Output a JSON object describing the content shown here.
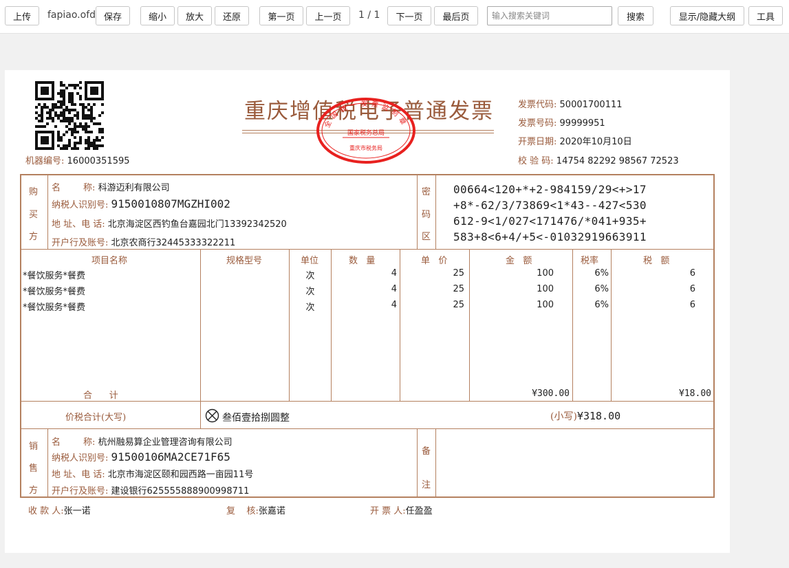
{
  "toolbar": {
    "upload": "上传",
    "filename": "fapiao.ofd",
    "save": "保存",
    "zoom_out": "缩小",
    "zoom_in": "放大",
    "reset": "还原",
    "first_page": "第一页",
    "prev_page": "上一页",
    "page_indicator": "1 / 1",
    "next_page": "下一页",
    "last_page": "最后页",
    "search_placeholder": "输入搜索关键词",
    "search": "搜索",
    "toggle_outline": "显示/隐藏大纲",
    "tools": "工具"
  },
  "invoice": {
    "title": "重庆增值税电子普通发票",
    "machine_no_label": "机器编号:",
    "machine_no": "16000351595",
    "code_label": "发票代码:",
    "code": "50001700111",
    "number_label": "发票号码:",
    "number": "99999951",
    "date_label": "开票日期:",
    "date": "2020年10月10日",
    "check_label": "校 验 码:",
    "check_code": "14754 82292 98567 72523",
    "stamp": {
      "top_text": "全国统一发票监制章",
      "middle_text": "国家税务总局",
      "bottom_text": "重庆市税务局",
      "color": "#e8211f"
    },
    "buyer": {
      "side_label": [
        "购",
        "买",
        "方"
      ],
      "name_label": "名        称:",
      "name": "科游迈利有限公司",
      "tax_id_label": "纳税人识别号:",
      "tax_id": "9150010807MGZHI002",
      "address_label": "地 址、电 话:",
      "address": "北京海淀区西钓鱼台嘉园北门13392342520",
      "bank_label": "开户行及账号:",
      "bank": "北京农商行32445333322211"
    },
    "cipher": {
      "side_label": [
        "密",
        "码",
        "区"
      ],
      "lines": [
        "00664<120+*+2-984159/29<+>17",
        "+8*-62/3/73869<1*43--427<530",
        "612-9<1/027<171476/*041+935+",
        "583+8<6+4/+5<-01032919663911"
      ]
    },
    "columns": {
      "item": "项目名称",
      "spec": "规格型号",
      "unit": "单位",
      "qty": "数   量",
      "price": "单   价",
      "amount": "金   额",
      "rate": "税率",
      "tax": "税   额"
    },
    "items": [
      {
        "name": "*餐饮服务*餐费",
        "unit": "次",
        "qty": "4",
        "price": "25",
        "amount": "100",
        "rate": "6%",
        "tax": "6"
      },
      {
        "name": "*餐饮服务*餐费",
        "unit": "次",
        "qty": "4",
        "price": "25",
        "amount": "100",
        "rate": "6%",
        "tax": "6"
      },
      {
        "name": "*餐饮服务*餐费",
        "unit": "次",
        "qty": "4",
        "price": "25",
        "amount": "100",
        "rate": "6%",
        "tax": "6"
      }
    ],
    "total_label": "合      计",
    "total_amount": "¥300.00",
    "total_tax": "¥18.00",
    "grand_label": "价税合计(大写)",
    "grand_upper": "叁佰壹拾捌圆整",
    "grand_small_label": "(小写)",
    "grand_small": "¥318.00",
    "seller": {
      "side_label": [
        "销",
        "售",
        "方"
      ],
      "name_label": "名        称:",
      "name": "杭州融易算企业管理咨询有限公司",
      "tax_id_label": "纳税人识别号:",
      "tax_id": "91500106MA2CE71F65",
      "address_label": "地 址、电 话:",
      "address": "北京市海淀区颐和园西路一亩园11号",
      "bank_label": "开户行及账号:",
      "bank": "建设银行625555888900998711"
    },
    "remarks_label": [
      "备",
      "注"
    ],
    "payee_label": "收 款 人:",
    "payee": "张一诺",
    "reviewer_label": "复    核:",
    "reviewer": "张嘉诺",
    "drawer_label": "开 票 人:",
    "drawer": "任盈盈",
    "ink_color": "#9a5b3c",
    "border_color": "#b4805f"
  }
}
